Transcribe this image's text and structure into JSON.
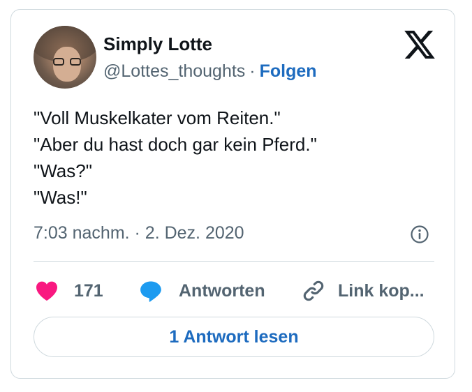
{
  "author": {
    "name": "Simply Lotte",
    "handle": "@Lottes_thoughts",
    "separator": "·",
    "follow_label": "Folgen"
  },
  "tweet": {
    "lines": [
      "\"Voll Muskelkater vom Reiten.\"",
      "\"Aber du hast doch gar kein Pferd.\"",
      "\"Was?\"",
      "\"Was!\""
    ],
    "timestamp": "7:03 nachm. · 2. Dez. 2020"
  },
  "actions": {
    "like_count": "171",
    "reply_label": "Antworten",
    "link_label": "Link kop..."
  },
  "read_replies_label": "1 Antwort lesen",
  "icons": {
    "logo": "x-logo-icon",
    "info": "info-icon",
    "like": "heart-icon",
    "reply": "speech-bubble-icon",
    "link": "link-icon"
  },
  "colors": {
    "heart": "#f91880",
    "reply": "#1d9bf0",
    "link_accent": "#1d6bbf",
    "muted": "#536471"
  }
}
